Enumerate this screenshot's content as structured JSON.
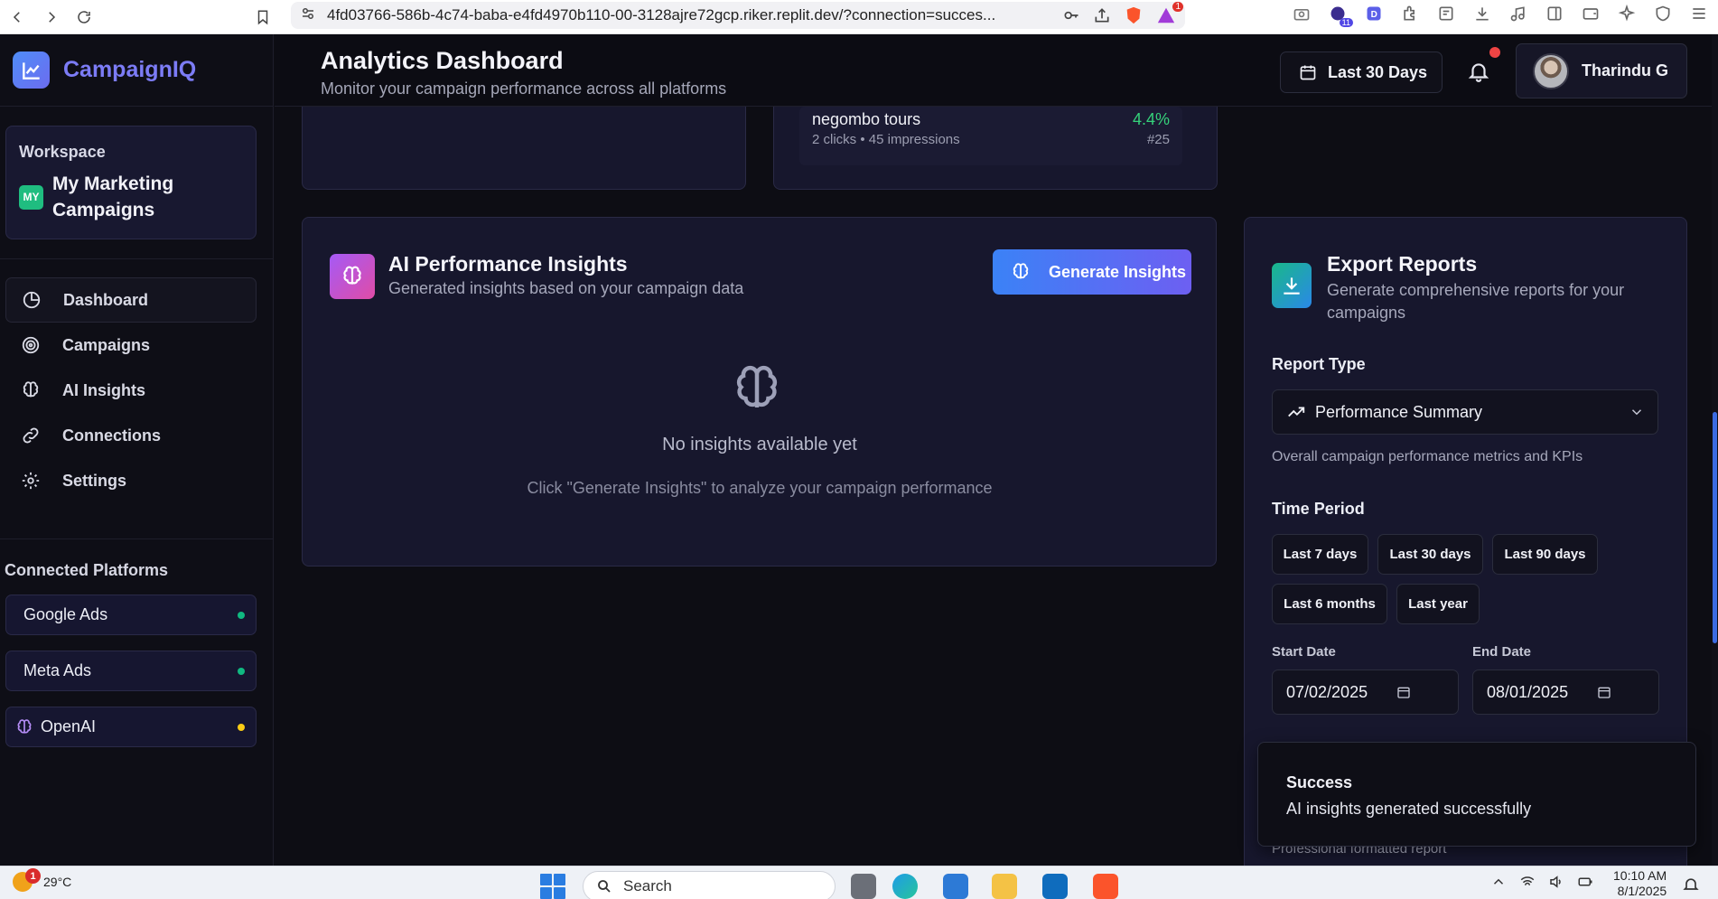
{
  "browser": {
    "url": "4fd03766-586b-4c74-baba-e4fd4970b110-00-3128ajre72gcp.riker.replit.dev/?connection=succes...",
    "notification_badge": "1",
    "ext_badge": "11"
  },
  "brand": {
    "name": "CampaignIQ"
  },
  "workspace": {
    "label": "Workspace",
    "badge": "MY",
    "name": "My Marketing Campaigns"
  },
  "nav": {
    "items": [
      {
        "label": "Dashboard",
        "icon": "pie-chart-icon",
        "active": true
      },
      {
        "label": "Campaigns",
        "icon": "target-icon"
      },
      {
        "label": "AI Insights",
        "icon": "brain-icon"
      },
      {
        "label": "Connections",
        "icon": "link-icon"
      },
      {
        "label": "Settings",
        "icon": "gear-icon"
      }
    ]
  },
  "connected_platforms": {
    "title": "Connected Platforms",
    "items": [
      {
        "label": "Google Ads",
        "status_color": "#10b981"
      },
      {
        "label": "Meta Ads",
        "status_color": "#10b981"
      },
      {
        "label": "OpenAI",
        "status_color": "#facc15"
      }
    ]
  },
  "header": {
    "title": "Analytics Dashboard",
    "subtitle": "Monitor your campaign performance across all platforms",
    "date_range": "Last 30 Days",
    "user_name": "Tharindu G"
  },
  "keyword": {
    "name": "negombo tours",
    "meta": "2 clicks • 45 impressions",
    "rate": "4.4%",
    "rank": "#25"
  },
  "ai_insights": {
    "title": "AI Performance Insights",
    "subtitle": "Generated insights based on your campaign data",
    "button": "Generate Insights",
    "empty_title": "No insights available yet",
    "empty_sub": "Click \"Generate Insights\" to analyze your campaign performance"
  },
  "export": {
    "title": "Export Reports",
    "subtitle": "Generate comprehensive reports for your campaigns",
    "report_type_label": "Report Type",
    "report_type_value": "Performance Summary",
    "report_type_desc": "Overall campaign performance metrics and KPIs",
    "time_period_label": "Time Period",
    "periods": [
      "Last 7 days",
      "Last 30 days",
      "Last 90 days",
      "Last 6 months",
      "Last year"
    ],
    "start_label": "Start Date",
    "start_value": "07/02/2025",
    "end_label": "End Date",
    "end_value": "08/01/2025",
    "footer": "Professional formatted report"
  },
  "toast": {
    "title": "Success",
    "message": "AI insights generated successfully"
  },
  "taskbar": {
    "weather_temp": "29°C",
    "weather_badge": "1",
    "search_placeholder": "Search",
    "time": "10:10 AM",
    "date": "8/1/2025"
  },
  "colors": {
    "accent": "#7c7cf6",
    "primary_btn_from": "#3b82f6",
    "primary_btn_to": "#6d5ff2",
    "success": "#35d27a"
  }
}
